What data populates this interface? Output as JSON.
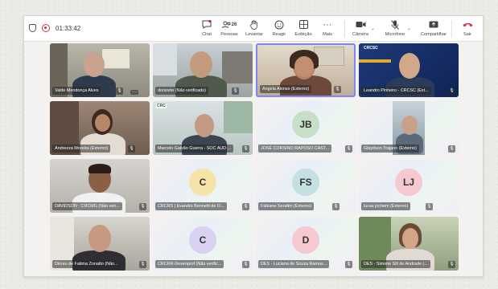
{
  "toolbar": {
    "timer": "01:33:42",
    "buttons": {
      "chat": "Chat",
      "people": "Pessoas",
      "people_count": "26",
      "raise": "Levantar",
      "react": "Reagir",
      "view": "Exibição",
      "more": "Mais",
      "camera": "Câmera",
      "mic": "Microfone",
      "share": "Compartilhar",
      "leave": "Sair"
    }
  },
  "participants": [
    {
      "name": "Valde Mendonça Alves",
      "type": "video"
    },
    {
      "name": "donizete (Não verificado)",
      "type": "video"
    },
    {
      "name": "Angela Alonso (Externo)",
      "type": "video"
    },
    {
      "name": "Leandro Pinheiro - CRCSC (Ext...",
      "type": "video"
    },
    {
      "name": "Andrezza Moreira (Externo)",
      "type": "video"
    },
    {
      "name": "Marcelo Galvão Guerra - SOC AUD ...",
      "type": "video"
    },
    {
      "name": "JOSÉ CORSINO RAPOSO CAST...",
      "type": "avatar",
      "initials": "JB",
      "color": "#c7dfc7"
    },
    {
      "name": "Glaydson Trajano (Externo)",
      "type": "video"
    },
    {
      "name": "DAVIDSON - CRCMG (Não veri...",
      "type": "video"
    },
    {
      "name": "CRCRS | Evandro Bennetti de O...",
      "type": "avatar",
      "initials": "C",
      "color": "#f6e3a8"
    },
    {
      "name": "Fabiane Serafim (Externo)",
      "type": "avatar",
      "initials": "FS",
      "color": "#c4e0e3"
    },
    {
      "name": "lucas jochem (Externo)",
      "type": "avatar",
      "initials": "LJ",
      "color": "#f5c9cf"
    },
    {
      "name": "Dirceu de Fatima Zonatto (Não...",
      "type": "video"
    },
    {
      "name": "CRCRR-Desenprof (Não verific...",
      "type": "avatar",
      "initials": "C",
      "color": "#d9d1f2"
    },
    {
      "name": "DES - Luciana de Souza Ramos...",
      "type": "avatar",
      "initials": "D",
      "color": "#f5c9cf"
    },
    {
      "name": "DES - Simone Sill de Andrade (...",
      "type": "video"
    }
  ],
  "logo_text": "CRCSC",
  "logo_text_2": "CRC"
}
